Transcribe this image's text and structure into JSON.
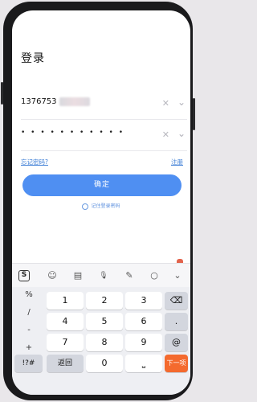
{
  "login": {
    "title": "登录",
    "phone_visible": "1376753",
    "password_mask": "• • • • • • • • • • •",
    "clear_glyph": "✕",
    "dropdown_glyph": "⌄",
    "forgot_label": "忘记密码?",
    "register_label": "注册",
    "confirm_label": "确定",
    "remember_label": "记住登录密码"
  },
  "keyboard": {
    "toolbar": {
      "sogou": "S",
      "emoji": "☺",
      "clipboard": "▤",
      "mic": "🎙",
      "handwrite": "✎",
      "search": "○",
      "collapse": "⌄"
    },
    "symbols": [
      "%",
      "/",
      "-",
      "+"
    ],
    "digits": [
      "1",
      "2",
      "3",
      "4",
      "5",
      "6",
      "7",
      "8",
      "9",
      "0"
    ],
    "backspace": "⌫",
    "dot": ".",
    "at": "@",
    "symbol_key": "!?#",
    "back_label": "返回",
    "space_glyph": "⎵",
    "next_label": "下一项"
  },
  "colors": {
    "accent": "#4f8ff2",
    "link": "#3f7fd6",
    "next_key": "#f46a2e"
  }
}
